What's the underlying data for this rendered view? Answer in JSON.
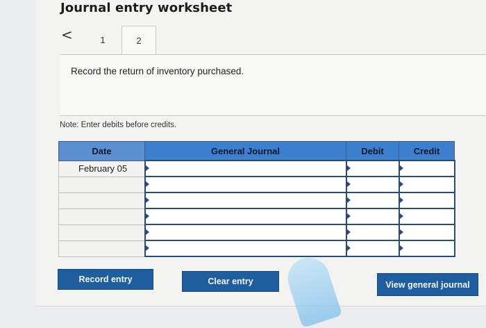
{
  "header": {
    "title": "Journal entry worksheet"
  },
  "pager": {
    "prev_symbol": "<",
    "tabs": [
      {
        "label": "1"
      },
      {
        "label": "2"
      }
    ],
    "active_tab": "2"
  },
  "instruction": "Record the return of inventory purchased.",
  "note": "Note: Enter debits before credits.",
  "journal_table": {
    "columns": [
      "Date",
      "General Journal",
      "Debit",
      "Credit"
    ],
    "rows": [
      {
        "date": "February 05",
        "account": "",
        "debit": "",
        "credit": ""
      },
      {
        "date": "",
        "account": "",
        "debit": "",
        "credit": ""
      },
      {
        "date": "",
        "account": "",
        "debit": "",
        "credit": ""
      },
      {
        "date": "",
        "account": "",
        "debit": "",
        "credit": ""
      },
      {
        "date": "",
        "account": "",
        "debit": "",
        "credit": ""
      },
      {
        "date": "",
        "account": "",
        "debit": "",
        "credit": ""
      }
    ]
  },
  "buttons": {
    "record": "Record entry",
    "clear": "Clear entry",
    "view": "View general journal"
  },
  "colors": {
    "header_blue": "#3d7fcf",
    "button_blue": "#1f5e9e",
    "input_border": "#2a4b73"
  }
}
